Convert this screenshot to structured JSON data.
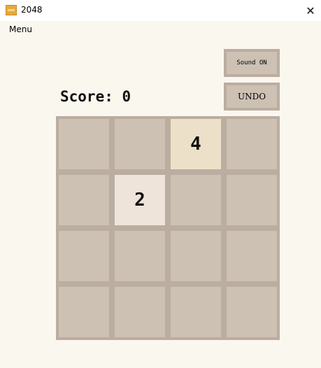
{
  "window": {
    "title": "2048",
    "close_glyph": "✕"
  },
  "menubar": {
    "items": [
      "Menu"
    ]
  },
  "controls": {
    "sound_label": "Sound ON",
    "undo_label": "UNDO"
  },
  "score": {
    "label": "Score:",
    "value": "0"
  },
  "board": {
    "rows": [
      [
        "",
        "",
        "4",
        ""
      ],
      [
        "",
        "2",
        "",
        ""
      ],
      [
        "",
        "",
        "",
        ""
      ],
      [
        "",
        "",
        "",
        ""
      ]
    ]
  },
  "colors": {
    "background": "#faf7ef",
    "board": "#bbada0",
    "empty_cell": "#cdc1b4",
    "tile_2": "#eee4da",
    "tile_4": "#ede0c8"
  }
}
